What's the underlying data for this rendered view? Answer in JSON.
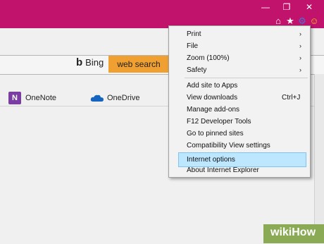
{
  "window_controls": {
    "minimize": "—",
    "restore": "❐",
    "close": "✕"
  },
  "toolbar_icons": {
    "home": "⌂",
    "favorites": "★",
    "tools": "⚙",
    "feedback": "☺"
  },
  "colors": {
    "titlebar": "#c1126c",
    "highlight_box": "#22e22b",
    "websearch": "#f0a030"
  },
  "search": {
    "bing_logo": "b",
    "bing_label": "Bing",
    "web_search_button": "web search"
  },
  "quick_links": [
    {
      "icon": "N",
      "label": "OneNote"
    },
    {
      "label": "OneDrive"
    }
  ],
  "menu": {
    "group1": [
      {
        "label": "Print",
        "arrow": "›"
      },
      {
        "label": "File",
        "arrow": "›"
      },
      {
        "label": "Zoom (100%)",
        "arrow": "›"
      },
      {
        "label": "Safety",
        "arrow": "›"
      }
    ],
    "group2": [
      {
        "label": "Add site to Apps"
      },
      {
        "label": "View downloads",
        "shortcut": "Ctrl+J"
      },
      {
        "label": "Manage add-ons"
      },
      {
        "label": "F12 Developer Tools"
      },
      {
        "label": "Go to pinned sites"
      },
      {
        "label": "Compatibility View settings"
      }
    ],
    "internet_options": "Internet options",
    "about": "About Internet Explorer"
  },
  "watermark": {
    "text": "wikiHow"
  }
}
